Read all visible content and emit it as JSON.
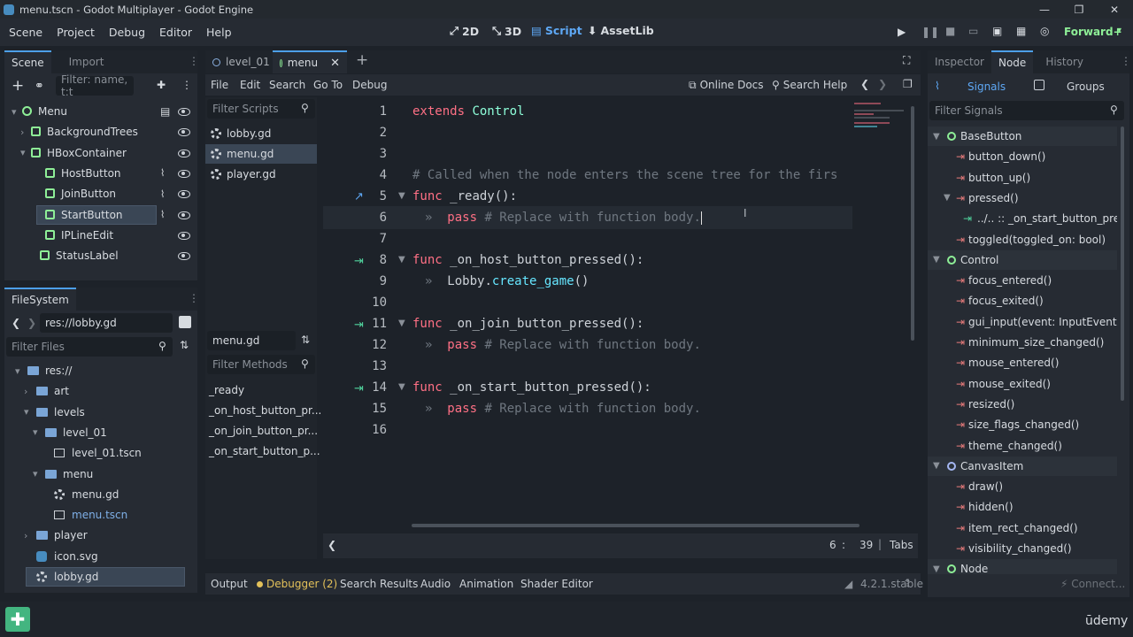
{
  "window": {
    "title": "menu.tscn - Godot Multiplayer - Godot Engine"
  },
  "menubar": {
    "items": [
      "Scene",
      "Project",
      "Debug",
      "Editor",
      "Help"
    ],
    "workspaces": [
      "2D",
      "3D",
      "Script",
      "AssetLib"
    ],
    "renderer": "Forward+"
  },
  "scene_dock": {
    "tabs": [
      "Scene",
      "Import"
    ],
    "filter_placeholder": "Filter: name, t:t",
    "nodes": [
      {
        "label": "Menu",
        "icon": "control-circle-icon",
        "color": "#8eef97"
      },
      {
        "label": "BackgroundTrees",
        "icon": "texture-rect-icon",
        "color": "#8eef97"
      },
      {
        "label": "HBoxContainer",
        "icon": "hbox-icon",
        "color": "#8eef97"
      },
      {
        "label": "HostButton",
        "icon": "button-icon",
        "color": "#8eef97"
      },
      {
        "label": "JoinButton",
        "icon": "button-icon",
        "color": "#8eef97"
      },
      {
        "label": "StartButton",
        "icon": "button-icon",
        "color": "#8eef97"
      },
      {
        "label": "IPLineEdit",
        "icon": "line-edit-icon",
        "color": "#8eef97"
      },
      {
        "label": "StatusLabel",
        "icon": "label-icon",
        "color": "#8eef97"
      }
    ]
  },
  "filesystem_dock": {
    "title": "FileSystem",
    "path": "res://lobby.gd",
    "filter_placeholder": "Filter Files",
    "items": [
      "res://",
      "art",
      "levels",
      "level_01",
      "level_01.tscn",
      "menu",
      "menu.gd",
      "menu.tscn",
      "player",
      "icon.svg",
      "lobby.gd"
    ]
  },
  "editor_tabs": [
    "level_01",
    "menu"
  ],
  "script_menu": [
    "File",
    "Edit",
    "Search",
    "Go To",
    "Debug"
  ],
  "script_help": {
    "docs": "Online Docs",
    "search": "Search Help"
  },
  "scripts_panel": {
    "filter_placeholder": "Filter Scripts",
    "scripts": [
      "lobby.gd",
      "menu.gd",
      "player.gd"
    ],
    "current": "menu.gd",
    "methods_filter_placeholder": "Filter Methods",
    "methods": [
      "_ready",
      "_on_host_button_pr...",
      "_on_join_button_pr...",
      "_on_start_button_p..."
    ]
  },
  "code": {
    "line_numbers": [
      "1",
      "2",
      "3",
      "4",
      "5",
      "6",
      "7",
      "8",
      "9",
      "10",
      "11",
      "12",
      "13",
      "14",
      "15",
      "16"
    ],
    "l1a": "extends",
    "l1b": "Control",
    "l4": "# Called when the node enters the scene tree for the firs",
    "l5a": "func",
    "l5b": "_ready():",
    "l6a": "pass",
    "l6b": "# Replace with function body.",
    "l8a": "func",
    "l8b": "_on_host_button_pressed():",
    "l9a": "Lobby.",
    "l9b": "create_game",
    "l9c": "()",
    "l11a": "func",
    "l11b": "_on_join_button_pressed():",
    "l12a": "pass",
    "l12b": "# Replace with function body.",
    "l14a": "func",
    "l14b": "_on_start_button_pressed():",
    "l15a": "pass",
    "l15b": "# Replace with function body."
  },
  "status": {
    "line": "6",
    "sep": ":",
    "col": "39",
    "indent": "Tabs"
  },
  "bottom_tabs": [
    "Output",
    "Debugger (2)",
    "Search Results",
    "Audio",
    "Animation",
    "Shader Editor"
  ],
  "version": "4.2.1.stable",
  "node_dock": {
    "tabs": [
      "Inspector",
      "Node",
      "History"
    ],
    "sub_tabs": [
      "Signals",
      "Groups"
    ],
    "filter_placeholder": "Filter Signals",
    "entries": [
      {
        "label": "BaseButton",
        "kind": "class"
      },
      {
        "label": "button_down()",
        "kind": "signal"
      },
      {
        "label": "button_up()",
        "kind": "signal"
      },
      {
        "label": "pressed()",
        "kind": "signal"
      },
      {
        "label": "../.. :: _on_start_button_pre...",
        "kind": "connection"
      },
      {
        "label": "toggled(toggled_on: bool)",
        "kind": "signal"
      },
      {
        "label": "Control",
        "kind": "class"
      },
      {
        "label": "focus_entered()",
        "kind": "signal"
      },
      {
        "label": "focus_exited()",
        "kind": "signal"
      },
      {
        "label": "gui_input(event: InputEvent)",
        "kind": "signal"
      },
      {
        "label": "minimum_size_changed()",
        "kind": "signal"
      },
      {
        "label": "mouse_entered()",
        "kind": "signal"
      },
      {
        "label": "mouse_exited()",
        "kind": "signal"
      },
      {
        "label": "resized()",
        "kind": "signal"
      },
      {
        "label": "size_flags_changed()",
        "kind": "signal"
      },
      {
        "label": "theme_changed()",
        "kind": "signal"
      },
      {
        "label": "CanvasItem",
        "kind": "class"
      },
      {
        "label": "draw()",
        "kind": "signal"
      },
      {
        "label": "hidden()",
        "kind": "signal"
      },
      {
        "label": "item_rect_changed()",
        "kind": "signal"
      },
      {
        "label": "visibility_changed()",
        "kind": "signal"
      },
      {
        "label": "Node",
        "kind": "class"
      }
    ],
    "connect_label": "Connect..."
  },
  "watermark": "ūdemy"
}
